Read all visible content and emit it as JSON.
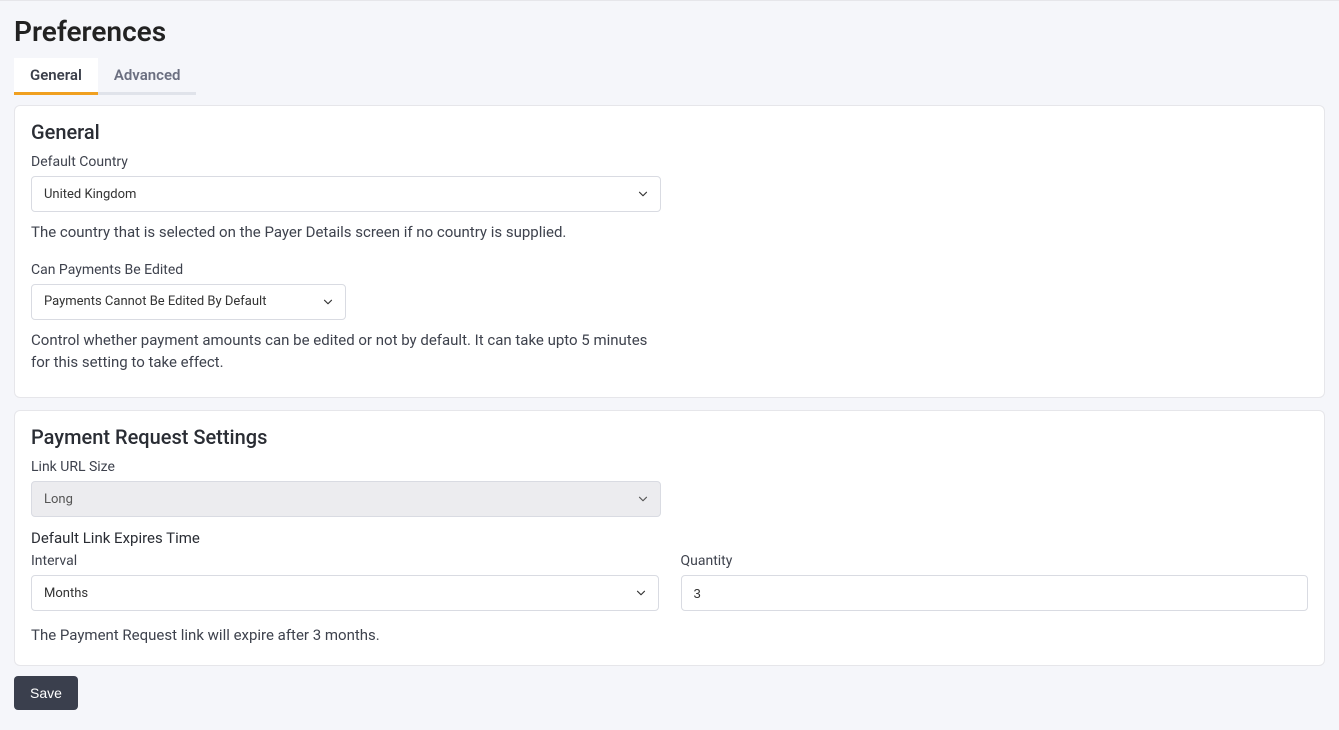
{
  "page_title": "Preferences",
  "tabs": {
    "general": "General",
    "advanced": "Advanced"
  },
  "general_section": {
    "heading": "General",
    "default_country": {
      "label": "Default Country",
      "value": "United Kingdom",
      "help": "The country that is selected on the Payer Details screen if no country is supplied."
    },
    "payments_edit": {
      "label": "Can Payments Be Edited",
      "value": "Payments Cannot Be Edited By Default",
      "help": "Control whether payment amounts can be edited or not by default. It can take upto 5 minutes for this setting to take effect."
    }
  },
  "payment_request_section": {
    "heading": "Payment Request Settings",
    "link_url_size": {
      "label": "Link URL Size",
      "value": "Long"
    },
    "default_link_expires_heading": "Default Link Expires Time",
    "interval": {
      "label": "Interval",
      "value": "Months"
    },
    "quantity": {
      "label": "Quantity",
      "value": "3"
    },
    "expiry_help": "The Payment Request link will expire after 3 months."
  },
  "save_button_label": "Save"
}
